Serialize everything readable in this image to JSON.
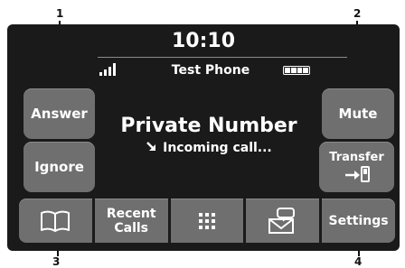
{
  "callouts": {
    "c1": "1",
    "c2": "2",
    "c3": "3",
    "c4": "4"
  },
  "status_bar": {
    "time": "10:10",
    "device_name": "Test Phone",
    "signal_icon": "signal-bars-icon",
    "battery_icon": "battery-icon"
  },
  "call": {
    "caller": "Private Number",
    "status_icon": "incoming-arrow-icon",
    "status_text": "Incoming call..."
  },
  "buttons": {
    "answer": "Answer",
    "ignore": "Ignore",
    "mute": "Mute",
    "transfer": "Transfer",
    "transfer_icon": "transfer-to-phone-icon"
  },
  "bottom_bar": [
    {
      "icon": "phonebook-icon"
    },
    {
      "label": "Recent\nCalls"
    },
    {
      "icon": "keypad-icon"
    },
    {
      "icon": "messages-icon"
    },
    {
      "label": "Settings"
    }
  ],
  "colors": {
    "screen_bg": "#1a1a1a",
    "button_bg": "#6f6f6f",
    "text": "#ffffff"
  }
}
